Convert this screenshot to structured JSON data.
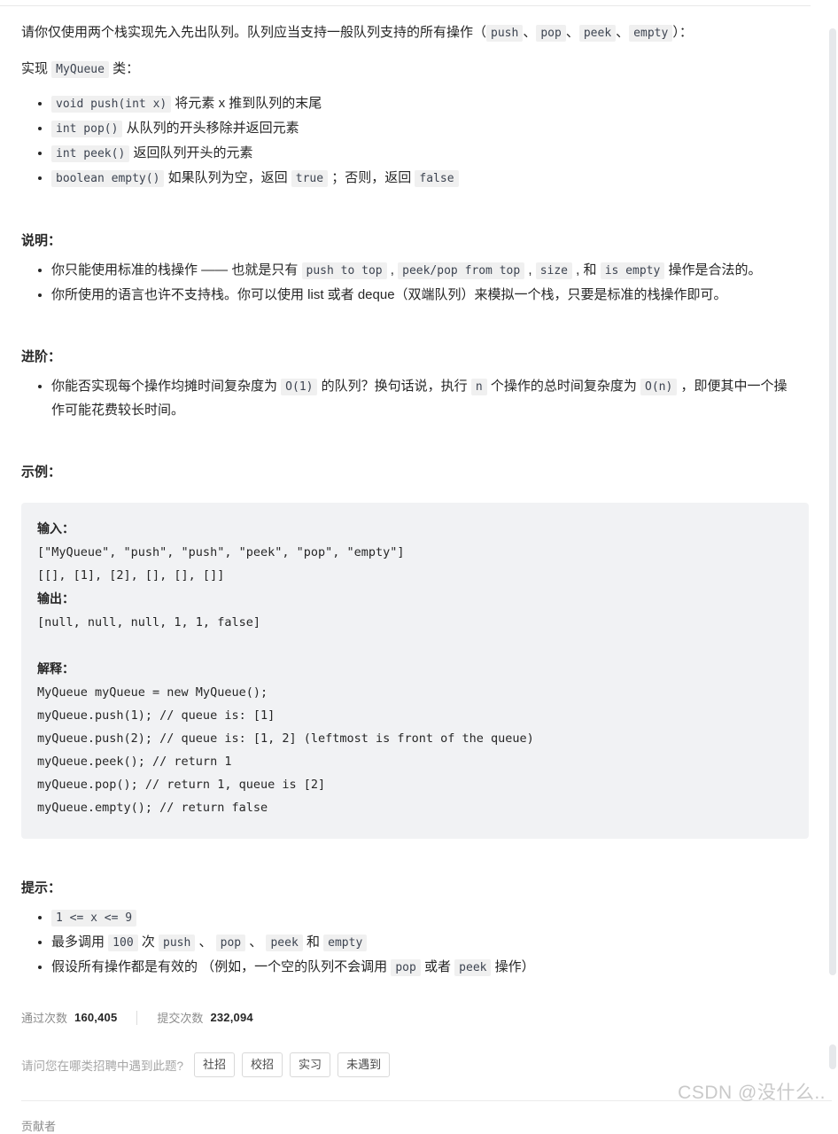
{
  "intro": {
    "paragraph1_a": "请你仅使用两个栈实现先入先出队列。队列应当支持一般队列支持的所有操作（",
    "code_push": "push",
    "sep1": "、",
    "code_pop": "pop",
    "sep2": "、",
    "code_peek": "peek",
    "sep3": "、",
    "code_empty": "empty",
    "paragraph1_b": "）：",
    "paragraph2_a": "实现 ",
    "code_myqueue": "MyQueue",
    "paragraph2_b": " 类："
  },
  "methods": [
    {
      "code": "void push(int x)",
      "desc": " 将元素 x 推到队列的末尾"
    },
    {
      "code": "int pop()",
      "desc": " 从队列的开头移除并返回元素"
    },
    {
      "code": "int peek()",
      "desc": " 返回队列开头的元素"
    },
    {
      "code": "boolean empty()",
      "desc_a": " 如果队列为空，返回 ",
      "code_true": "true",
      "desc_b": " ；否则，返回 ",
      "code_false": "false"
    }
  ],
  "notes": {
    "title": "说明：",
    "item1_a": "你只能使用标准的栈操作 —— 也就是只有 ",
    "item1_code1": "push to top",
    "item1_b": " , ",
    "item1_code2": "peek/pop from top",
    "item1_c": " , ",
    "item1_code3": "size",
    "item1_d": " , 和 ",
    "item1_code4": "is empty",
    "item1_e": " 操作是合法的。",
    "item2": "你所使用的语言也许不支持栈。你可以使用 list 或者 deque（双端队列）来模拟一个栈，只要是标准的栈操作即可。"
  },
  "advanced": {
    "title": "进阶：",
    "item_a": "你能否实现每个操作均摊时间复杂度为 ",
    "item_code1": "O(1)",
    "item_b": " 的队列？换句话说，执行 ",
    "item_code2": "n",
    "item_c": " 个操作的总时间复杂度为 ",
    "item_code3": "O(n)",
    "item_d": " ，即便其中一个操作可能花费较长时间。"
  },
  "example": {
    "title": "示例：",
    "input_label": "输入：",
    "input_line1": "[\"MyQueue\", \"push\", \"push\", \"peek\", \"pop\", \"empty\"]",
    "input_line2": "[[], [1], [2], [], [], []]",
    "output_label": "输出：",
    "output_line": "[null, null, null, 1, 1, false]",
    "explain_label": "解释：",
    "explain_lines": [
      "MyQueue myQueue = new MyQueue();",
      "myQueue.push(1); // queue is: [1]",
      "myQueue.push(2); // queue is: [1, 2] (leftmost is front of the queue)",
      "myQueue.peek(); // return 1",
      "myQueue.pop(); // return 1, queue is [2]",
      "myQueue.empty(); // return false"
    ]
  },
  "hints": {
    "title": "提示：",
    "item1_code": "1 <= x <= 9",
    "item2_a": "最多调用 ",
    "item2_code1": "100",
    "item2_b": " 次 ",
    "item2_code2": "push",
    "item2_c": " 、 ",
    "item2_code3": "pop",
    "item2_d": " 、 ",
    "item2_code4": "peek",
    "item2_e": " 和 ",
    "item2_code5": "empty",
    "item3_a": "假设所有操作都是有效的 （例如，一个空的队列不会调用 ",
    "item3_code1": "pop",
    "item3_b": " 或者 ",
    "item3_code2": "peek",
    "item3_c": " 操作）"
  },
  "stats": {
    "accepted_label": "通过次数",
    "accepted_value": "160,405",
    "submissions_label": "提交次数",
    "submissions_value": "232,094"
  },
  "poll": {
    "question": "请问您在哪类招聘中遇到此题?",
    "options": [
      "社招",
      "校招",
      "实习",
      "未遇到"
    ]
  },
  "footer": {
    "contributors_label": "贡献者",
    "watermark": "CSDN @没什么.."
  },
  "colors": {
    "text": "#262626",
    "muted": "#8c8c8c",
    "code_bg": "#f0f0f0",
    "block_bg": "#f1f2f4",
    "scrollbar": "#e6e8eb"
  }
}
